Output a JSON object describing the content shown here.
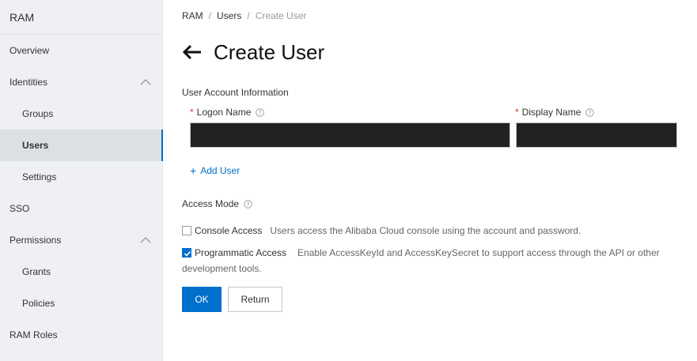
{
  "sidebar": {
    "title": "RAM",
    "items": [
      {
        "label": "Overview"
      },
      {
        "label": "Identities"
      },
      {
        "label": "Groups"
      },
      {
        "label": "Users"
      },
      {
        "label": "Settings"
      },
      {
        "label": "SSO"
      },
      {
        "label": "Permissions"
      },
      {
        "label": "Grants"
      },
      {
        "label": "Policies"
      },
      {
        "label": "RAM Roles"
      }
    ]
  },
  "breadcrumb": {
    "items": [
      "RAM",
      "Users",
      "Create User"
    ],
    "separator": "/"
  },
  "page": {
    "title": "Create User"
  },
  "form": {
    "section_label": "User Account Information",
    "logon_name": {
      "required": "*",
      "label": "Logon Name",
      "value": ""
    },
    "display_name": {
      "required": "*",
      "label": "Display Name",
      "value": ""
    },
    "add_user_label": "Add User",
    "access_mode_label": "Access Mode",
    "console_access": {
      "label": "Console Access",
      "description": "Users access the Alibaba Cloud console using the account and password.",
      "checked": false
    },
    "programmatic_access": {
      "label": "Programmatic Access",
      "description_line1": "Enable AccessKeyId and AccessKeySecret to support access through the API or other",
      "description_line2": "development tools.",
      "checked": true
    }
  },
  "buttons": {
    "ok": "OK",
    "return": "Return"
  },
  "colors": {
    "accent": "#0070cc",
    "required": "#e0332f",
    "sidebar_bg": "#eef0f3"
  }
}
